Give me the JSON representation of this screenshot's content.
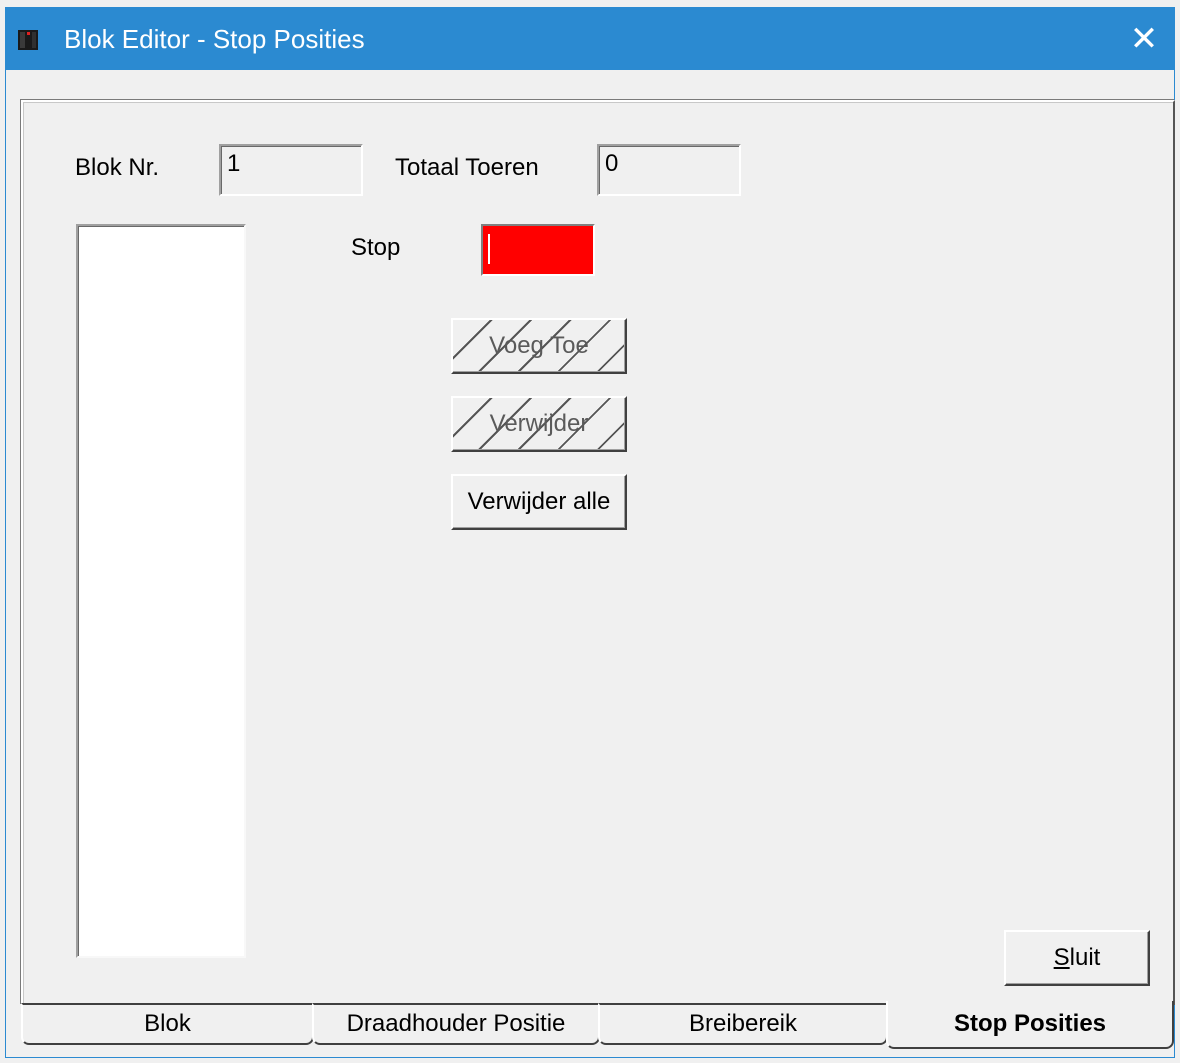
{
  "window": {
    "title": "Blok Editor - Stop Posities",
    "close_glyph": "✕",
    "icon": "app-icon"
  },
  "form": {
    "blok_nr_label": "Blok Nr.",
    "blok_nr_value": "1",
    "totaal_toeren_label": "Totaal Toeren",
    "totaal_toeren_value": "0",
    "stop_label": "Stop",
    "stop_value": "",
    "stop_field_color": "#ff0000"
  },
  "buttons": {
    "voeg_toe": "Voeg Toe",
    "verwijder": "Verwijder",
    "verwijder_alle": "Verwijder alle",
    "sluit_mnemonic": "S",
    "sluit_rest": "luit"
  },
  "listbox": {
    "items": []
  },
  "tabs": [
    {
      "label": "Blok",
      "active": false
    },
    {
      "label": "Draadhouder Positie",
      "active": false
    },
    {
      "label": "Breibereik",
      "active": false
    },
    {
      "label": "Stop Posities",
      "active": true
    }
  ],
  "colors": {
    "titlebar": "#2b8ad1",
    "face": "#f0f0f0"
  }
}
